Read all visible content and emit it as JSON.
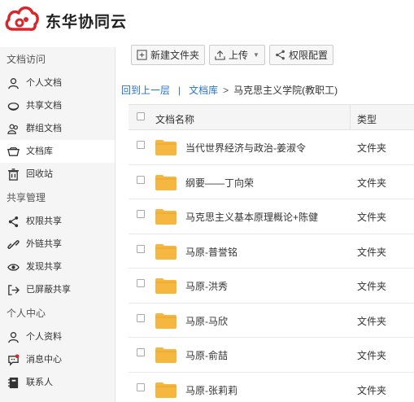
{
  "brand": {
    "name": "东华协同云",
    "icon": "cloud-logo-icon",
    "accent": "#d9262b"
  },
  "sidebar": {
    "sections": [
      {
        "title": "文档访问",
        "items": [
          {
            "label": "个人文档",
            "icon": "person-icon"
          },
          {
            "label": "共享文档",
            "icon": "shared-docs-icon"
          },
          {
            "label": "群组文档",
            "icon": "group-icon"
          },
          {
            "label": "文档库",
            "icon": "library-icon",
            "active": true
          },
          {
            "label": "回收站",
            "icon": "trash-icon"
          }
        ]
      },
      {
        "title": "共享管理",
        "items": [
          {
            "label": "权限共享",
            "icon": "share-icon"
          },
          {
            "label": "外链共享",
            "icon": "link-icon"
          },
          {
            "label": "发现共享",
            "icon": "eye-icon"
          },
          {
            "label": "已屏蔽共享",
            "icon": "blocked-share-icon"
          }
        ]
      },
      {
        "title": "个人中心",
        "items": [
          {
            "label": "个人资料",
            "icon": "profile-icon"
          },
          {
            "label": "消息中心",
            "icon": "message-icon"
          },
          {
            "label": "联系人",
            "icon": "contacts-icon"
          }
        ]
      }
    ]
  },
  "toolbar": {
    "new_folder": "新建文件夹",
    "upload": "上传",
    "permission": "权限配置"
  },
  "breadcrumb": {
    "back": "回到上一层",
    "separator": "|",
    "library": "文档库",
    "arrow": ">",
    "current": "马克思主义学院(教职工)"
  },
  "table": {
    "columns": {
      "name": "文档名称",
      "type": "类型"
    },
    "rows": [
      {
        "name": "当代世界经济与政治-姜淑令",
        "type": "文件夹"
      },
      {
        "name": "纲要——丁向荣",
        "type": "文件夹"
      },
      {
        "name": "马克思主义基本原理概论+陈健",
        "type": "文件夹"
      },
      {
        "name": "马原-普誉铭",
        "type": "文件夹"
      },
      {
        "name": "马原-洪秀",
        "type": "文件夹"
      },
      {
        "name": "马原-马欣",
        "type": "文件夹"
      },
      {
        "name": "马原-俞喆",
        "type": "文件夹"
      },
      {
        "name": "马原-张莉莉",
        "type": "文件夹"
      }
    ]
  },
  "colors": {
    "folder": "#f5b73f",
    "link": "#2a74c8",
    "sidebar_bg": "#f5f5f5"
  }
}
